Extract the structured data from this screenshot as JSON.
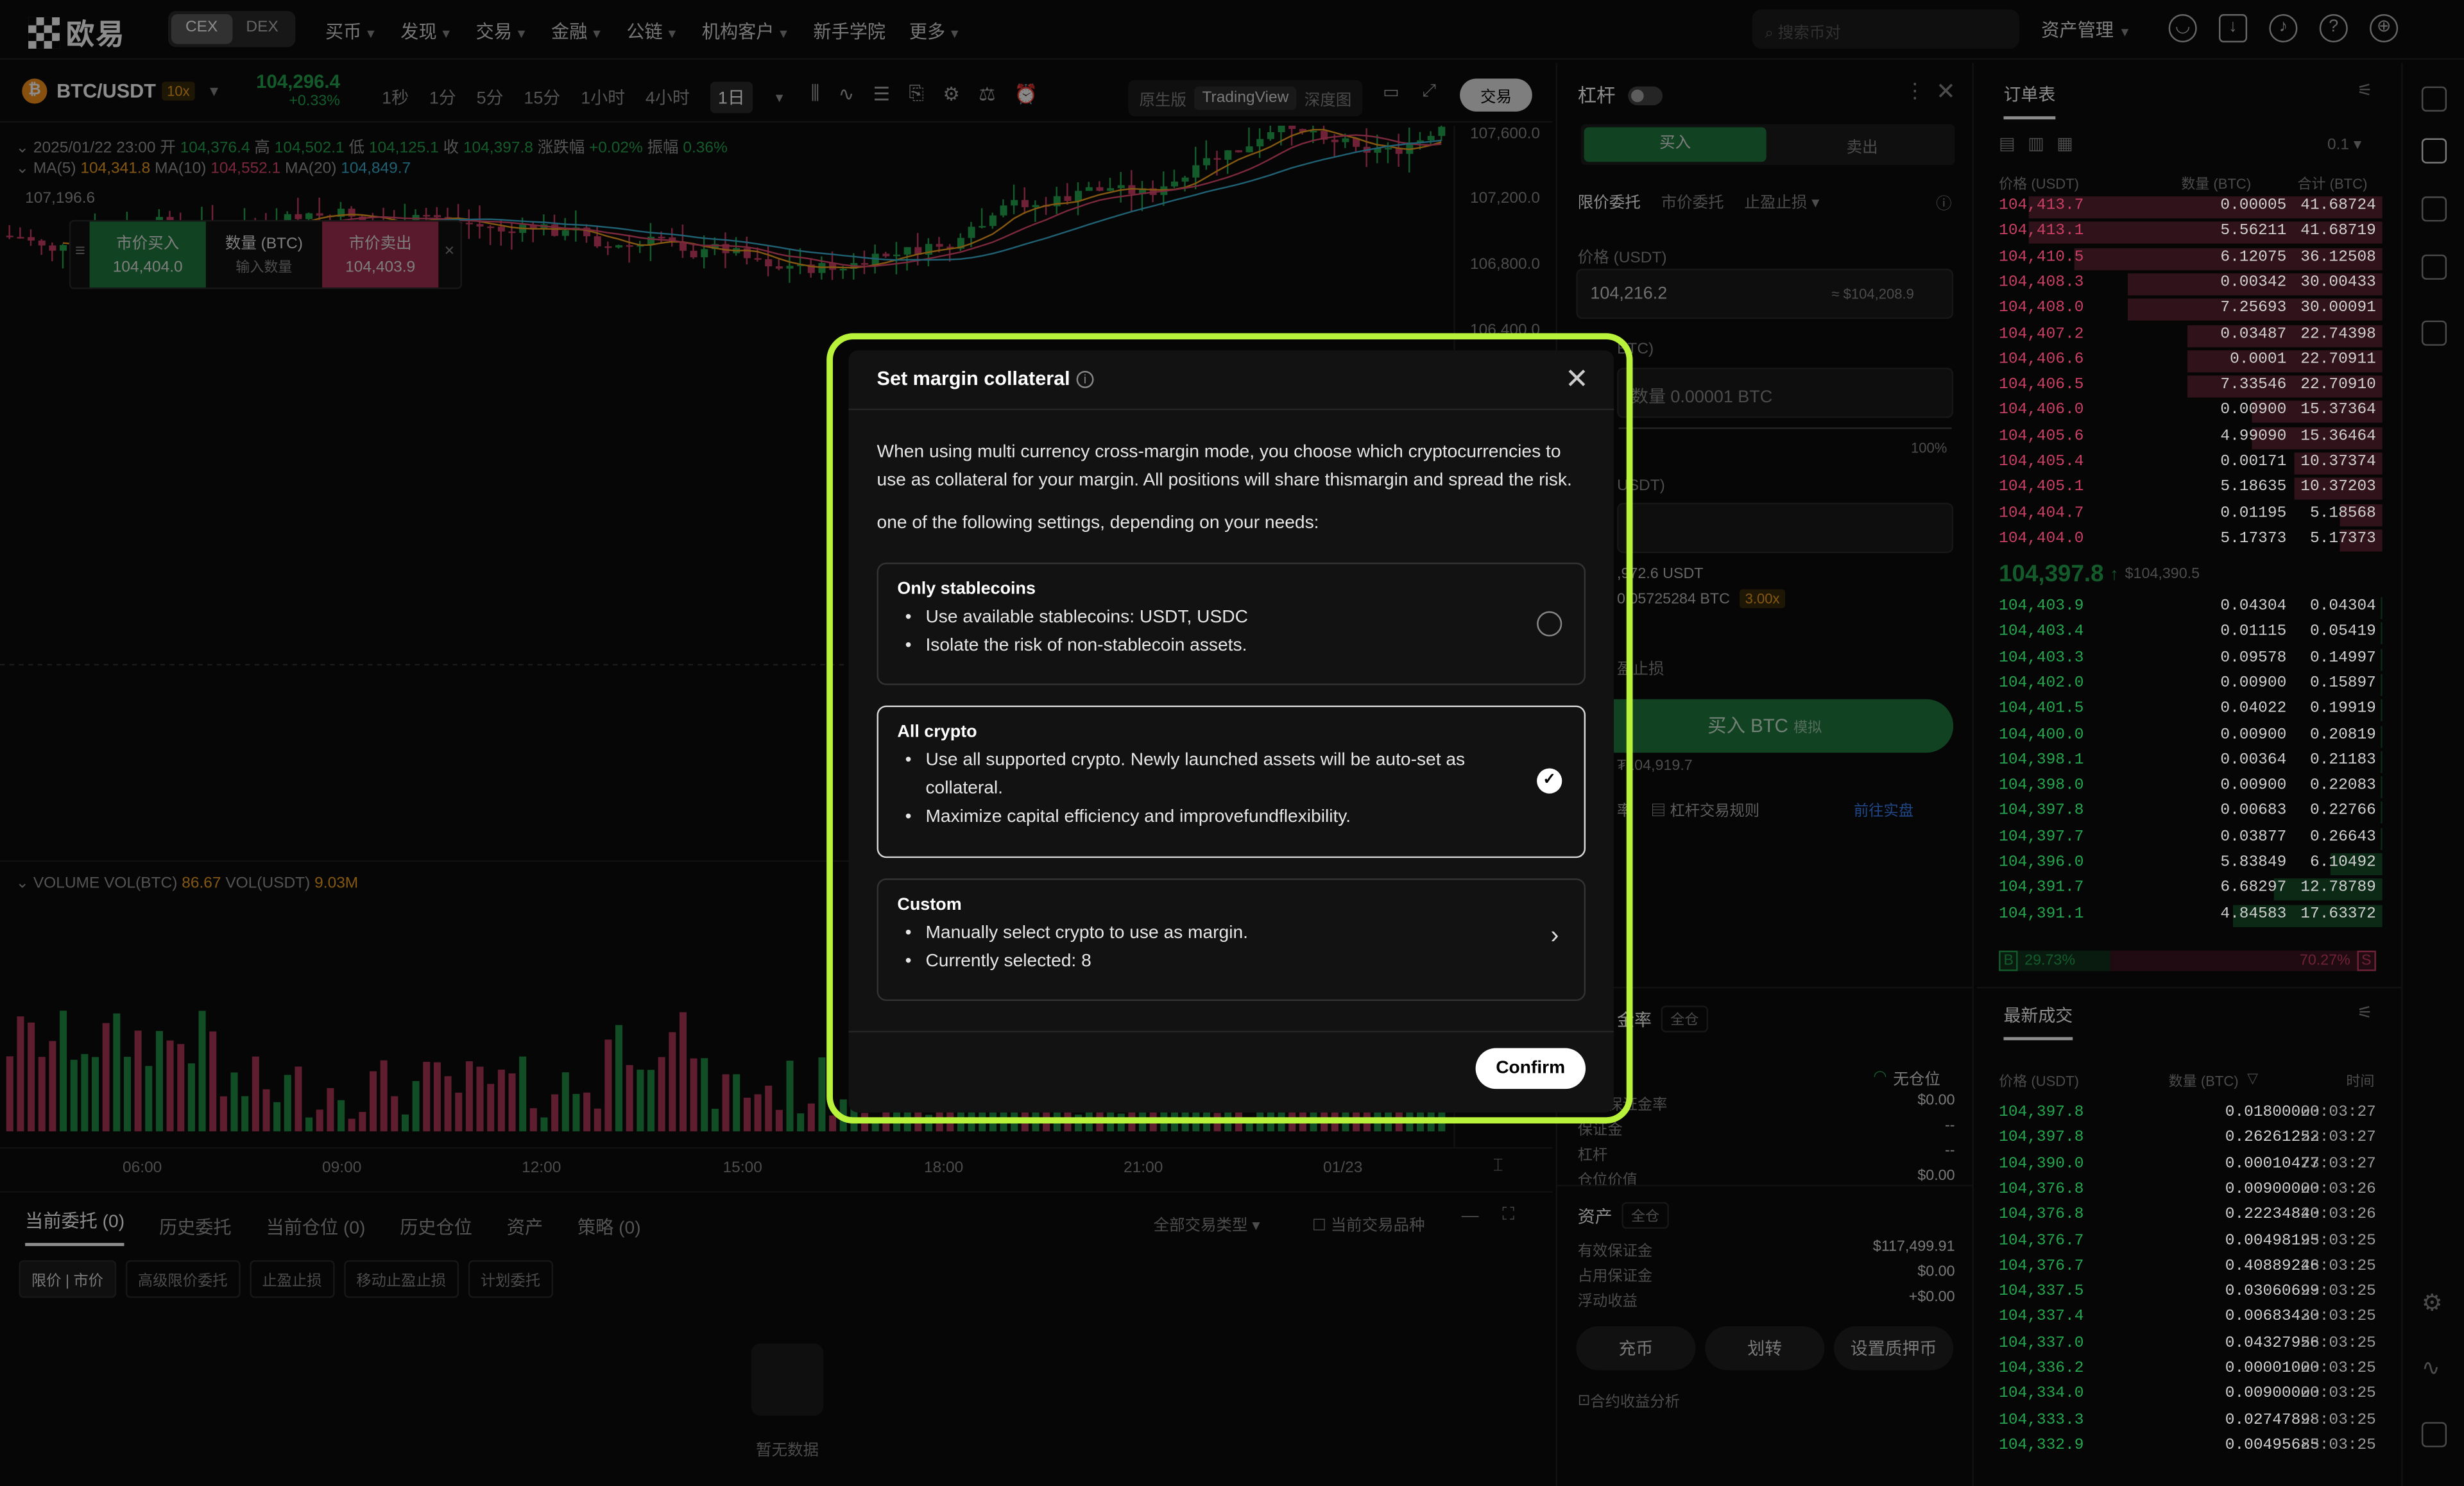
{
  "nav": {
    "logo": "欧易",
    "cex": "CEX",
    "dex": "DEX",
    "items": [
      "买币",
      "发现",
      "交易",
      "金融",
      "公链",
      "机构客户",
      "新手学院",
      "更多"
    ],
    "search_placeholder": "搜索币对",
    "assets": "资产管理"
  },
  "ticker": {
    "pair": "BTC/USDT",
    "leverage": "10x",
    "price": "104,296.4",
    "change": "+0.33%"
  },
  "timeframes": [
    "1秒",
    "1分",
    "5分",
    "15分",
    "1小时",
    "4小时",
    "1日"
  ],
  "view_modes": [
    "原生版",
    "TradingView",
    "深度图"
  ],
  "trade_btn": "交易",
  "ohlc": {
    "date": "2025/01/22 23:00",
    "o_label": "开",
    "o": "104,376.4",
    "h_label": "高",
    "h": "104,502.1",
    "l_label": "低",
    "l": "104,125.1",
    "c_label": "收",
    "c": "104,397.8",
    "chg_label": "涨跌幅",
    "chg": "+0.02%",
    "amp_label": "振幅",
    "amp": "0.36%"
  },
  "ma": {
    "ma5_label": "MA(5)",
    "ma5": "104,341.8",
    "ma10_label": "MA(10)",
    "ma10": "104,552.1",
    "ma20_label": "MA(20)",
    "ma20": "104,849.7"
  },
  "low_mark": "107,196.6",
  "quick": {
    "buy_label": "市价买入",
    "buy_price": "104,404.0",
    "qty_label": "数量 (BTC)",
    "qty_ph": "输入数量",
    "sell_label": "市价卖出",
    "sell_price": "104,403.9"
  },
  "price_axis": [
    "107,600.0",
    "107,200.0",
    "106,800.0",
    "106,400.0"
  ],
  "volume": {
    "label": "VOLUME",
    "vbtc_label": "VOL(BTC)",
    "vbtc": "86.67",
    "vusdt_label": "VOL(USDT)",
    "vusdt": "9.03M"
  },
  "xaxis": [
    "06:00",
    "09:00",
    "12:00",
    "15:00",
    "18:00",
    "21:00",
    "01/23"
  ],
  "bottom": {
    "tabs": [
      "当前委托 (0)",
      "历史委托",
      "当前仓位 (0)",
      "历史仓位",
      "资产",
      "策略 (0)"
    ],
    "filter": "全部交易类型",
    "current_only": "当前交易品种",
    "chips": [
      "限价 | 市价",
      "高级限价委托",
      "止盈止损",
      "移动止盈止损",
      "计划委托"
    ],
    "empty": "暂无数据"
  },
  "order": {
    "title": "杠杆",
    "buy": "买入",
    "sell": "卖出",
    "types": [
      "限价委托",
      "市价委托",
      "止盈止损"
    ],
    "price_label": "价格 (USDT)",
    "price": "104,216.2",
    "price_usd": "≈ $104,208.9",
    "qty_label": "BTC)",
    "qty_ph": "数量 0.00001 BTC",
    "pct": "100%",
    "amt_label": "USDT)",
    "avail1": ",972.6 USDT",
    "avail2": "0.05725284 BTC",
    "avail2_lev": "3.00x",
    "tpsl": "盈止损",
    "buy_btn": "买入 BTC",
    "buy_btn_tag": "模拟",
    "est": "₮104,919.7",
    "rule1": "率",
    "rule2": "杠杆交易规则",
    "goto": "前往实盘",
    "margin_title": "金率",
    "margin_mode": "全仓",
    "no_pos": "无仓位",
    "margin_rows": [
      [
        "维持保证金率",
        "$0.00"
      ],
      [
        "保证金",
        "--"
      ],
      [
        "杠杆",
        "--"
      ],
      [
        "仓位价值",
        "$0.00"
      ]
    ],
    "assets_title": "资产",
    "assets_mode": "全仓",
    "asset_rows": [
      [
        "有效保证金",
        "$117,499.91"
      ],
      [
        "占用保证金",
        "$0.00"
      ],
      [
        "浮动收益",
        "+$0.00"
      ]
    ],
    "deposit": "充币",
    "transfer": "划转",
    "collateral": "设置质押币",
    "analysis": "合约收益分析"
  },
  "book": {
    "title": "订单表",
    "step": "0.1",
    "headers": [
      "价格 (USDT)",
      "数量 (BTC)",
      "合计 (BTC)"
    ],
    "asks": [
      [
        "104,413.7",
        "0.00005",
        "41.68724",
        100
      ],
      [
        "104,413.1",
        "5.56211",
        "41.68719",
        100
      ],
      [
        "104,410.5",
        "6.12075",
        "36.12508",
        87
      ],
      [
        "104,408.3",
        "0.00342",
        "30.00433",
        72
      ],
      [
        "104,408.0",
        "7.25693",
        "30.00091",
        72
      ],
      [
        "104,407.2",
        "0.03487",
        "22.74398",
        55
      ],
      [
        "104,406.6",
        "0.0001",
        "22.70911",
        55
      ],
      [
        "104,406.5",
        "7.33546",
        "22.70910",
        55
      ],
      [
        "104,406.0",
        "0.00900",
        "15.37364",
        37
      ],
      [
        "104,405.6",
        "4.99090",
        "15.36464",
        37
      ],
      [
        "104,405.4",
        "0.00171",
        "10.37374",
        25
      ],
      [
        "104,405.1",
        "5.18635",
        "10.37203",
        25
      ],
      [
        "104,404.7",
        "0.01195",
        "5.18568",
        12
      ],
      [
        "104,404.0",
        "5.17373",
        "5.17373",
        12
      ]
    ],
    "last": "104,397.8",
    "last_usd": "$104,390.5",
    "bids": [
      [
        "104,403.9",
        "0.04304",
        "0.04304",
        1
      ],
      [
        "104,403.4",
        "0.01115",
        "0.05419",
        1
      ],
      [
        "104,403.3",
        "0.09578",
        "0.14997",
        1
      ],
      [
        "104,402.0",
        "0.00900",
        "0.15897",
        1
      ],
      [
        "104,401.5",
        "0.04022",
        "0.19919",
        1
      ],
      [
        "104,400.0",
        "0.00900",
        "0.20819",
        1
      ],
      [
        "104,398.1",
        "0.00364",
        "0.21183",
        1
      ],
      [
        "104,398.0",
        "0.00900",
        "0.22083",
        1
      ],
      [
        "104,397.8",
        "0.00683",
        "0.22766",
        1
      ],
      [
        "104,397.7",
        "0.03877",
        "0.26643",
        1
      ],
      [
        "104,396.0",
        "5.83849",
        "6.10492",
        35
      ],
      [
        "104,391.7",
        "6.68297",
        "12.78789",
        73
      ],
      [
        "104,391.1",
        "4.84583",
        "17.63372",
        100
      ]
    ],
    "ratio_b": "29.73%",
    "ratio_s": "70.27%",
    "b": "B",
    "s": "S"
  },
  "trades": {
    "title": "最新成交",
    "headers": [
      "价格 (USDT)",
      "数量 (BTC)",
      "时间"
    ],
    "rows": [
      [
        "104,397.8",
        "0.01800000",
        "23:03:27"
      ],
      [
        "104,397.8",
        "0.26261252",
        "23:03:27"
      ],
      [
        "104,390.0",
        "0.00010477",
        "23:03:27"
      ],
      [
        "104,376.8",
        "0.00900000",
        "23:03:26"
      ],
      [
        "104,376.8",
        "0.22234840",
        "23:03:26"
      ],
      [
        "104,376.7",
        "0.00498195",
        "23:03:25"
      ],
      [
        "104,376.7",
        "0.40889246",
        "23:03:25"
      ],
      [
        "104,337.5",
        "0.03060699",
        "23:03:25"
      ],
      [
        "104,337.4",
        "0.00683430",
        "23:03:25"
      ],
      [
        "104,337.0",
        "0.04327956",
        "23:03:25"
      ],
      [
        "104,336.2",
        "0.00001000",
        "23:03:25"
      ],
      [
        "104,334.0",
        "0.00900000",
        "23:03:25"
      ],
      [
        "104,333.3",
        "0.02747898",
        "23:03:25"
      ],
      [
        "104,332.9",
        "0.00495685",
        "23:03:25"
      ]
    ]
  },
  "modal": {
    "title": "Set margin collateral",
    "desc1": "When using multi currency cross-margin mode, you choose which cryptocurrencies to use as collateral for your margin. All positions will share thismargin and spread the risk.",
    "desc2": "one of the following settings, depending on your needs:",
    "options": [
      {
        "title": "Only stablecoins",
        "bullets": [
          "Use available stablecoins: USDT, USDC",
          "Isolate the risk of non-stablecoin assets."
        ]
      },
      {
        "title": "All crypto",
        "bullets": [
          "Use all supported crypto. Newly launched assets will be auto-set as collateral.",
          "Maximize capital efficiency and improvefundflexibility."
        ]
      },
      {
        "title": "Custom",
        "bullets": [
          "Manually select crypto to use as margin.",
          "Currently selected: 8"
        ]
      }
    ],
    "confirm": "Confirm"
  },
  "colors": {
    "up": "#25a750",
    "down": "#ca3f64",
    "highlight": "#b9f23a",
    "ma5": "#f0a020",
    "ma10": "#e0496f",
    "ma20": "#3ab0d0"
  }
}
